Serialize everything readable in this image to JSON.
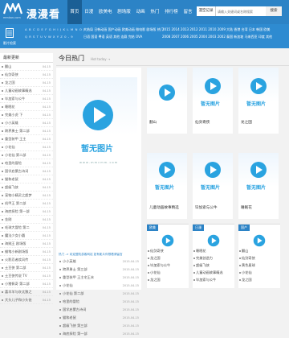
{
  "header": {
    "site_title": "漫漫看",
    "logo_sub": "mmkan.com",
    "nav": [
      "首页",
      "日漫",
      "欧美电",
      "剧场版",
      "动画",
      "热门",
      "排行榜",
      "留言",
      "会员登陆"
    ],
    "search_select": "漫空记录",
    "search_placeholder": "请输入关键词或名称搜索",
    "search_button": "搜索"
  },
  "subbar": {
    "label": "影片检索",
    "letters": "A B C D E F G H I J K L M N O P",
    "letters2": "Q R S T U V W X Y Z 0 - 9",
    "cat_row1": [
      "大结局",
      "日韩动画",
      "国产动画",
      "欧美动画",
      "微电影",
      "剧场版",
      "热门"
    ],
    "cat_row2": [
      "日语",
      "国语",
      "粤语",
      "英语",
      "其他",
      "连载",
      "完结",
      "OVA"
    ],
    "year_row1": "2015 2014 2013 2012 2011 2010 2009",
    "year_row2": "2008 2007 2006 2005 2004 2003 2002",
    "region_row1": [
      "大陆",
      "香港",
      "台湾",
      "日本",
      "韩国",
      "欧美"
    ],
    "region_row2": [
      "泰国",
      "新加坡",
      "马来西亚",
      "印度",
      "其他"
    ]
  },
  "sidebar": {
    "title": "最新更新",
    "items": [
      {
        "name": "翻山",
        "date": "04-15"
      },
      {
        "name": "仙剑奇侠",
        "date": "04-15"
      },
      {
        "name": "龙之国",
        "date": "04-15"
      },
      {
        "name": "儿童动画故事精选",
        "date": "04-15"
      },
      {
        "name": "毕加索与公牛",
        "date": "04-15"
      },
      {
        "name": "睡眠花",
        "date": "04-15"
      },
      {
        "name": "完美小虎 下",
        "date": "04-15"
      },
      {
        "name": "小小英雄",
        "date": "04-15"
      },
      {
        "name": "跨界勇士 第二部",
        "date": "04-15"
      },
      {
        "name": "重型装甲 王主",
        "date": "04-15"
      },
      {
        "name": "小花仙",
        "date": "04-15"
      },
      {
        "name": "小花仙 第二部",
        "date": "04-15"
      },
      {
        "name": "哈里的冒险",
        "date": "04-15"
      },
      {
        "name": "国学启蒙古诗词",
        "date": "04-15"
      },
      {
        "name": "猫和老鼠",
        "date": "04-15"
      },
      {
        "name": "超级飞侠",
        "date": "04-15"
      },
      {
        "name": "宠物小精灵之超梦",
        "date": "04-15"
      },
      {
        "name": "机甲王 第二部",
        "date": "04-15"
      },
      {
        "name": "海底探险 第一部",
        "date": "04-15"
      },
      {
        "name": "金刚",
        "date": "04-15"
      },
      {
        "name": "毛球大冒险 第二",
        "date": "04-15"
      },
      {
        "name": "魔法少女小圆",
        "date": "04-15"
      },
      {
        "name": "海贼王 剧场版",
        "date": "04-15"
      },
      {
        "name": "蜡笔小新剧场版",
        "date": "04-15"
      },
      {
        "name": "火影忍者疾风传",
        "date": "04-15"
      },
      {
        "name": "土豆侠 第二部",
        "date": "04-15"
      },
      {
        "name": "土豆侠传说 TV",
        "date": "04-15"
      },
      {
        "name": "小猪佩奇 第二部",
        "date": "04-15"
      },
      {
        "name": "喜羊羊与灰太狼之",
        "date": "04-15"
      },
      {
        "name": "大头儿子和小头爸",
        "date": "04-15"
      }
    ]
  },
  "main": {
    "title": "今日热门",
    "subtitle": "Hot today →",
    "noimg_text": "暂无图片",
    "watermark": "w w w . m m c m m . c o m",
    "featured_head": "热门 -> 欢迎登陆游客网站 如有影片你想看请留言",
    "featured_list": [
      {
        "name": "小小英雄",
        "date": "2015-04-15"
      },
      {
        "name": "跨界勇士 第三部",
        "date": "2015-04-15"
      },
      {
        "name": "重型装甲 王主宅王末",
        "date": "2015-04-15"
      },
      {
        "name": "小花仙",
        "date": "2015-04-15"
      },
      {
        "name": "小花仙 第二部",
        "date": "2015-04-15"
      },
      {
        "name": "哈里的冒险",
        "date": "2015-04-15"
      },
      {
        "name": "国学启蒙古诗词",
        "date": "2015-04-15"
      },
      {
        "name": "猫和老鼠",
        "date": "2015-04-15"
      },
      {
        "name": "超级飞侠 第三部",
        "date": "2015-04-15"
      },
      {
        "name": "海底探险 第一部",
        "date": "2015-04-15"
      }
    ],
    "cards": [
      {
        "name": "翻山"
      },
      {
        "name": "仙剑奇侠"
      },
      {
        "name": "龙之国"
      },
      {
        "name": "儿童动画故事精选"
      },
      {
        "name": "毕加索与公牛"
      },
      {
        "name": "睡眠花"
      }
    ],
    "panels": [
      {
        "tag": "欧美",
        "items": [
          "仙剑奇侠",
          "龙之国",
          "毕加索与公牛",
          "小花仙",
          "龙之国"
        ]
      },
      {
        "tag": "日漫",
        "items": [
          "睡眠花",
          "完美创造力",
          "超级飞侠",
          "儿童动画故事精选",
          "毕加索与公牛"
        ]
      },
      {
        "tag": "国产",
        "items": [
          "翻山",
          "仙剑奇侠",
          "黄色星球",
          "小花仙",
          "龙之国"
        ]
      }
    ]
  },
  "colors": {
    "primary": "#2c83c6",
    "secondary": "#2e8bd1",
    "accent": "#2aa3e0"
  }
}
